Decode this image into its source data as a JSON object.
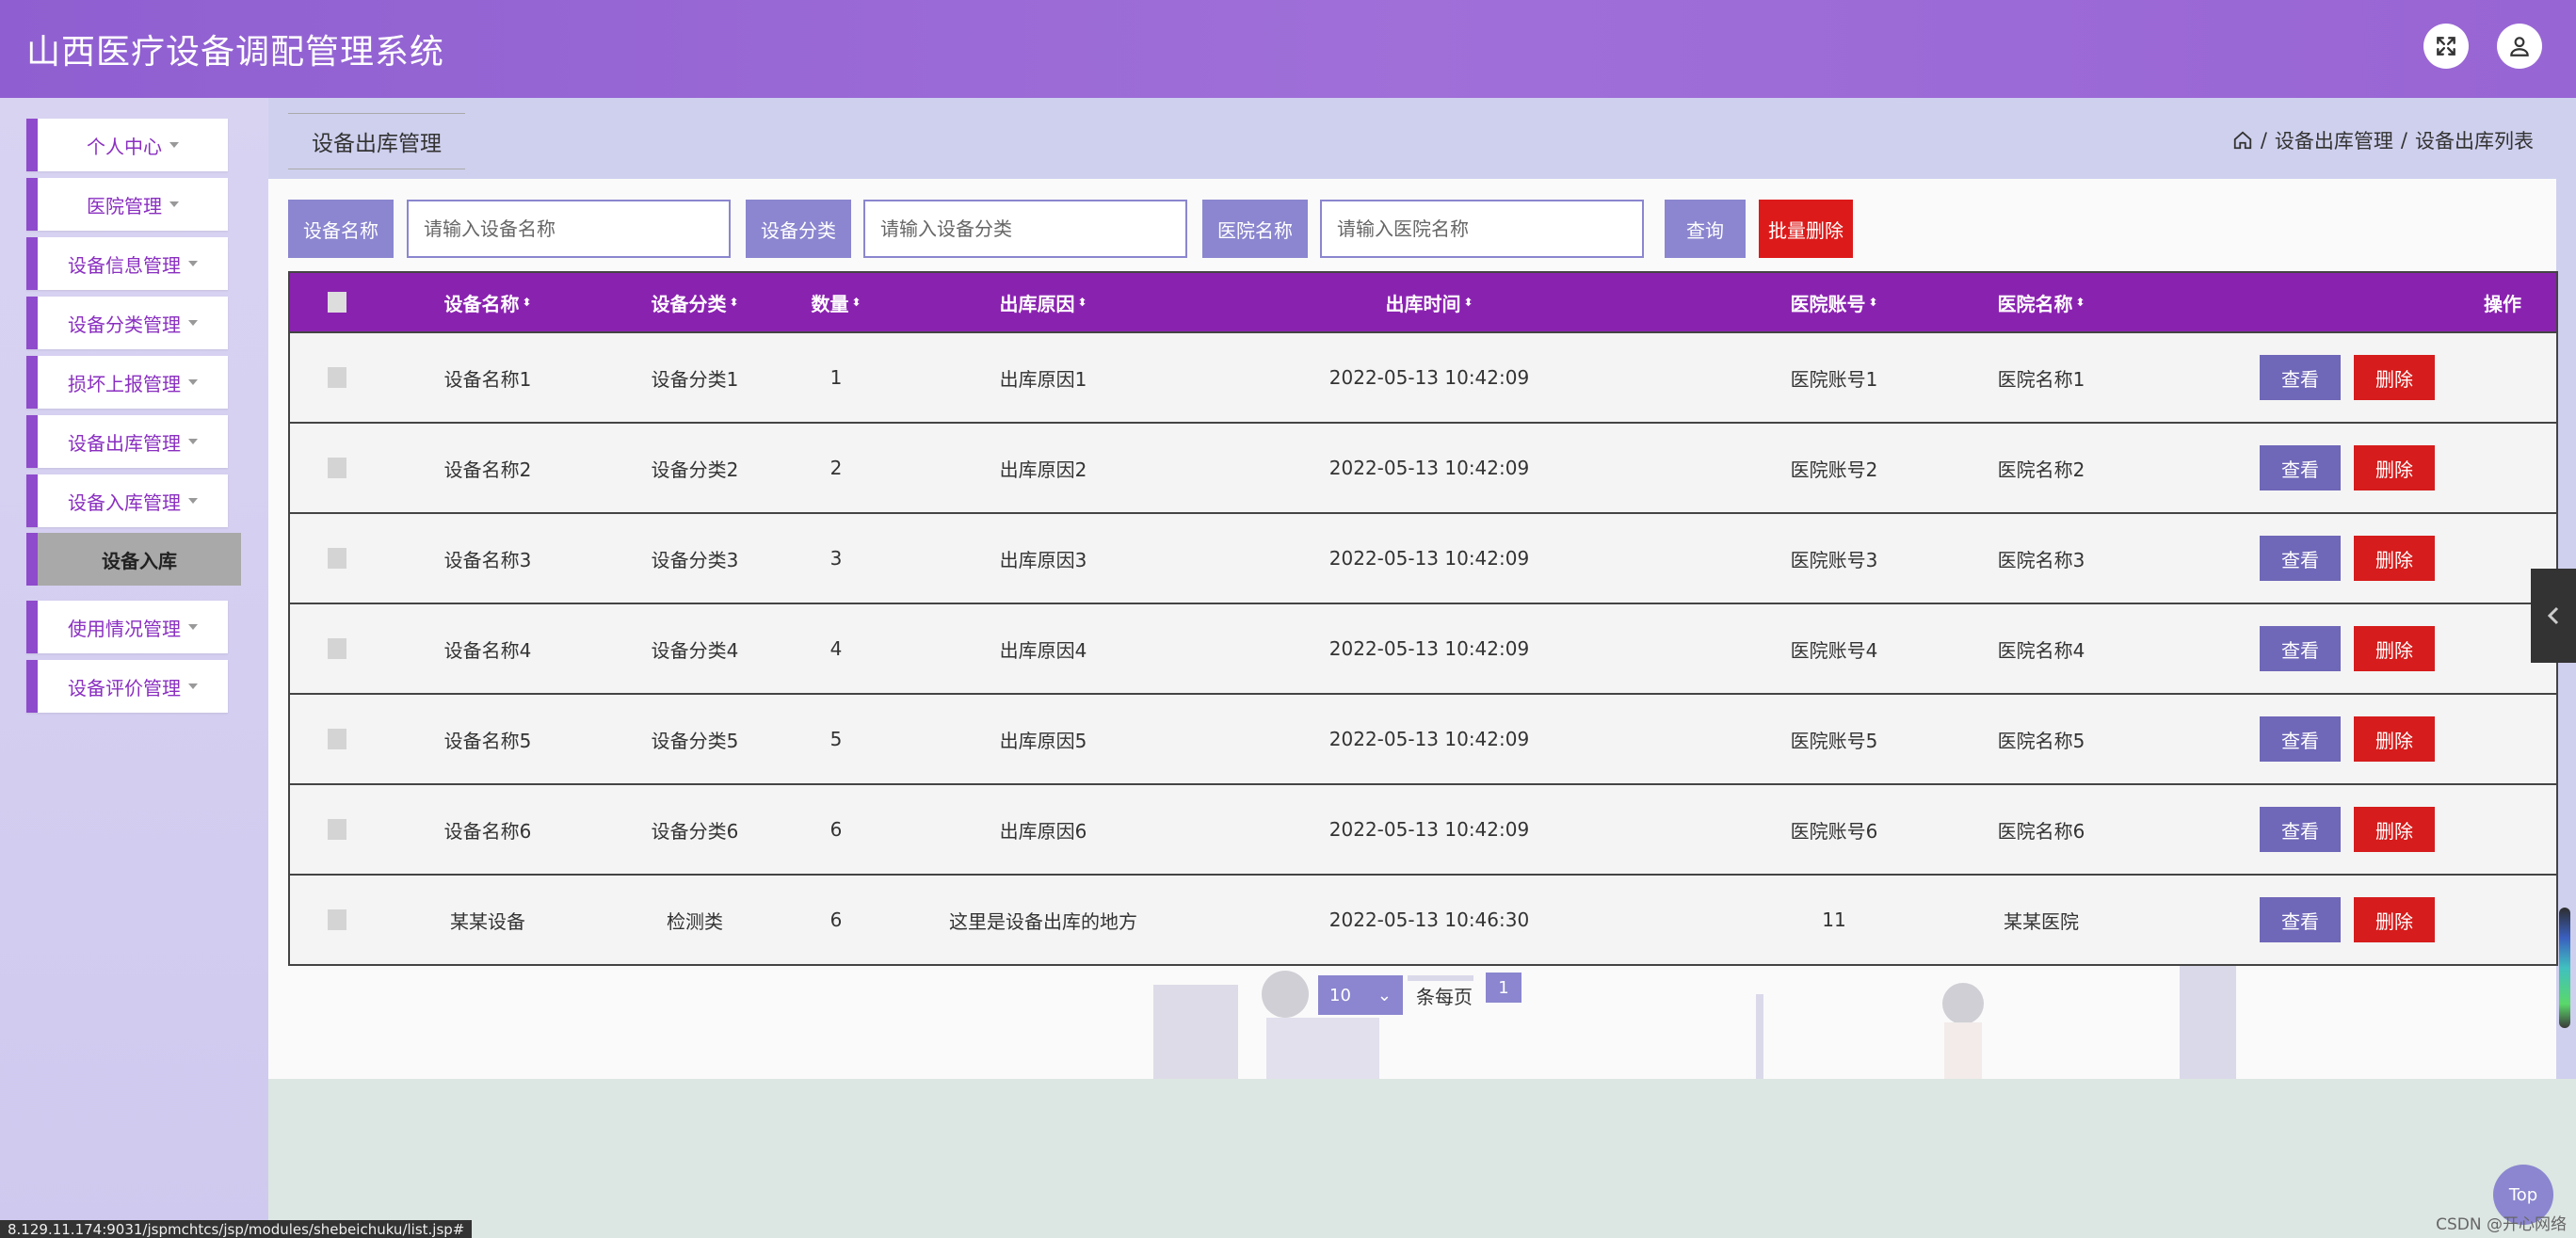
{
  "header": {
    "title": "山西医疗设备调配管理系统"
  },
  "sidebar": {
    "items": [
      {
        "label": "个人中心"
      },
      {
        "label": "医院管理"
      },
      {
        "label": "设备信息管理"
      },
      {
        "label": "设备分类管理"
      },
      {
        "label": "损坏上报管理"
      },
      {
        "label": "设备出库管理"
      },
      {
        "label": "设备入库管理"
      },
      {
        "label": "使用情况管理"
      },
      {
        "label": "设备评价管理"
      }
    ],
    "submenu_label": "设备入库"
  },
  "page": {
    "tab_title": "设备出库管理",
    "breadcrumb": [
      "设备出库管理",
      "设备出库列表"
    ],
    "breadcrumb_sep": "/"
  },
  "search": {
    "name_label": "设备名称",
    "name_placeholder": "请输入设备名称",
    "category_label": "设备分类",
    "category_placeholder": "请输入设备分类",
    "hospital_label": "医院名称",
    "hospital_placeholder": "请输入医院名称",
    "query_button": "查询",
    "batch_delete_button": "批量删除"
  },
  "table": {
    "columns": [
      "设备名称",
      "设备分类",
      "数量",
      "出库原因",
      "出库时间",
      "医院账号",
      "医院名称",
      "操作"
    ],
    "rows": [
      [
        "设备名称1",
        "设备分类1",
        "1",
        "出库原因1",
        "2022-05-13 10:42:09",
        "医院账号1",
        "医院名称1"
      ],
      [
        "设备名称2",
        "设备分类2",
        "2",
        "出库原因2",
        "2022-05-13 10:42:09",
        "医院账号2",
        "医院名称2"
      ],
      [
        "设备名称3",
        "设备分类3",
        "3",
        "出库原因3",
        "2022-05-13 10:42:09",
        "医院账号3",
        "医院名称3"
      ],
      [
        "设备名称4",
        "设备分类4",
        "4",
        "出库原因4",
        "2022-05-13 10:42:09",
        "医院账号4",
        "医院名称4"
      ],
      [
        "设备名称5",
        "设备分类5",
        "5",
        "出库原因5",
        "2022-05-13 10:42:09",
        "医院账号5",
        "医院名称5"
      ],
      [
        "设备名称6",
        "设备分类6",
        "6",
        "出库原因6",
        "2022-05-13 10:42:09",
        "医院账号6",
        "医院名称6"
      ],
      [
        "某某设备",
        "检测类",
        "6",
        "这里是设备出库的地方",
        "2022-05-13 10:46:30",
        "11",
        "某某医院"
      ]
    ],
    "view_button": "查看",
    "delete_button": "删除",
    "sort_glyph": "⬍"
  },
  "pager": {
    "page_size": "10",
    "per_page_text": "条每页",
    "current_page": "1"
  },
  "misc": {
    "top_button": "Top",
    "status_url": "8.129.11.174:9031/jspmchtcs/jsp/modules/shebeichuku/list.jsp#",
    "watermark": "CSDN @开心网络"
  },
  "colors": {
    "accent": "#8e4bcb",
    "table_header": "#8a22b0",
    "danger": "#d61c1c",
    "button": "#8b86cf"
  },
  "icons": {
    "fullscreen": "expand-icon",
    "user": "user-icon",
    "home": "home-icon",
    "collapse": "chevron-left-icon"
  }
}
